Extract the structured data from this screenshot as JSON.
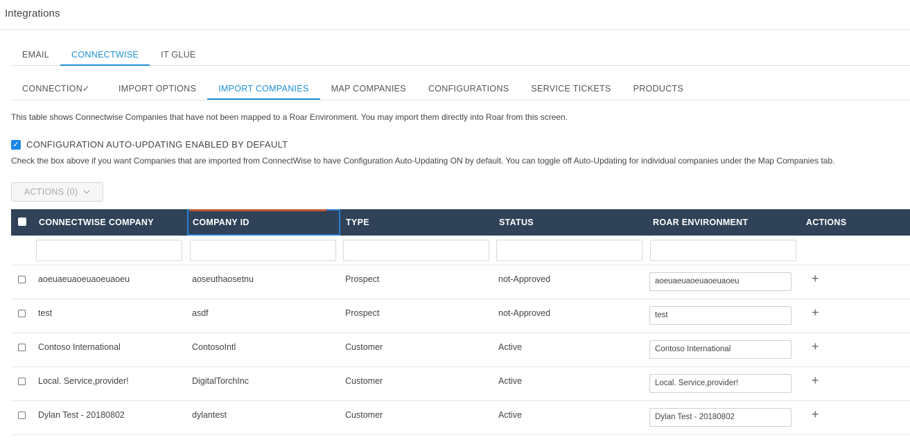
{
  "page": {
    "title": "Integrations"
  },
  "tabs": [
    {
      "label": "EMAIL",
      "active": false
    },
    {
      "label": "CONNECTWISE",
      "active": true
    },
    {
      "label": "IT GLUE",
      "active": false
    }
  ],
  "subtabs": [
    {
      "label": "CONNECTION✓",
      "active": false
    },
    {
      "label": "IMPORT OPTIONS",
      "active": false
    },
    {
      "label": "IMPORT COMPANIES",
      "active": true
    },
    {
      "label": "MAP COMPANIES",
      "active": false
    },
    {
      "label": "CONFIGURATIONS",
      "active": false
    },
    {
      "label": "SERVICE TICKETS",
      "active": false
    },
    {
      "label": "PRODUCTS",
      "active": false
    }
  ],
  "description": "This table shows Connectwise Companies that have not been mapped to a Roar Environment. You may import them directly into Roar from this screen.",
  "auto_update": {
    "label": "CONFIGURATION AUTO-UPDATING ENABLED BY DEFAULT",
    "checked": true,
    "help": "Check the box above if you want Companies that are imported from ConnectWise to have Configuration Auto-Updating ON by default. You can toggle off Auto-Updating for individual companies under the Map Companies tab."
  },
  "actions_dropdown": {
    "label": "ACTIONS (0)"
  },
  "table": {
    "headers": {
      "company": "CONNECTWISE COMPANY",
      "company_id": "COMPANY ID",
      "type": "TYPE",
      "status": "STATUS",
      "environment": "ROAR ENVIRONMENT",
      "actions": "ACTIONS"
    },
    "rows": [
      {
        "company": "aoeuaeuaoeuaoeuaoeu",
        "company_id": "aoseuthaosetnu",
        "type": "Prospect",
        "status": "not-Approved",
        "environment": "aoeuaeuaoeuaoeuaoeu"
      },
      {
        "company": "test",
        "company_id": "asdf",
        "type": "Prospect",
        "status": "not-Approved",
        "environment": "test"
      },
      {
        "company": "Contoso International",
        "company_id": "ContosoIntl",
        "type": "Customer",
        "status": "Active",
        "environment": "Contoso International"
      },
      {
        "company": "Local. Service,provider!",
        "company_id": "DigitalTorchInc",
        "type": "Customer",
        "status": "Active",
        "environment": "Local. Service,provider!"
      },
      {
        "company": "Dylan Test - 20180802",
        "company_id": "dylantest",
        "type": "Customer",
        "status": "Active",
        "environment": "Dylan Test - 20180802"
      }
    ]
  },
  "icons": {
    "add": "plus-icon",
    "dropdown": "chevron-down-icon",
    "check": "check-icon"
  },
  "colors": {
    "accent": "#1e8fd4",
    "header_bg": "#2f4257",
    "checkbox": "#1e88e5"
  }
}
